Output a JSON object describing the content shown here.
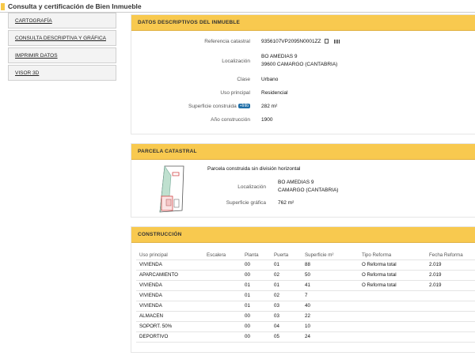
{
  "page": {
    "title": "Consulta y certificación de Bien Inmueble"
  },
  "colors": {
    "accent": "#f8c94f",
    "info_badge": "#1f6fa8"
  },
  "sidebar": {
    "items": [
      {
        "label": "CARTOGRAFÍA"
      },
      {
        "label": "CONSULTA DESCRIPTIVA Y GRÁFICA"
      },
      {
        "label": "IMPRIMIR DATOS"
      },
      {
        "label": "VISOR 3D"
      }
    ]
  },
  "datos": {
    "header": "DATOS DESCRIPTIVOS DEL INMUEBLE",
    "ref_label": "Referencia catastral",
    "ref_value": "9356107VP2095N0001ZZ",
    "loc_label": "Localización",
    "loc_line1": "BO AMEDIAS 9",
    "loc_line2": "39600 CAMARGO (CANTABRIA)",
    "clase_label": "Clase",
    "clase_value": "Urbano",
    "uso_label": "Uso principal",
    "uso_value": "Residencial",
    "sup_label": "Superficie construida",
    "sup_badge": "+Info",
    "sup_value": "282 m²",
    "anio_label": "Año construcción",
    "anio_value": "1900"
  },
  "parcela": {
    "header": "PARCELA CATASTRAL",
    "subtitle": "Parcela construida sin división horizontal",
    "loc_label": "Localización",
    "loc_line1": "BO AMEDIAS 9",
    "loc_line2": "CAMARGO (CANTABRIA)",
    "sup_label": "Superficie gráfica",
    "sup_value": "762 m²"
  },
  "construccion": {
    "header": "CONSTRUCCIÓN",
    "columns": [
      "Uso principal",
      "Escalera",
      "Planta",
      "Puerta",
      "Superficie m²",
      "Tipo Reforma",
      "Fecha Reforma"
    ],
    "rows": [
      [
        "VIVIENDA",
        "",
        "00",
        "01",
        "88",
        "O Reforma total",
        "2.019"
      ],
      [
        "APARCAMIENTO",
        "",
        "00",
        "02",
        "50",
        "O Reforma total",
        "2.019"
      ],
      [
        "VIVIENDA",
        "",
        "01",
        "01",
        "41",
        "O Reforma total",
        "2.019"
      ],
      [
        "VIVIENDA",
        "",
        "01",
        "02",
        "7",
        "",
        ""
      ],
      [
        "VIVIENDA",
        "",
        "01",
        "03",
        "40",
        "",
        ""
      ],
      [
        "ALMACEN",
        "",
        "00",
        "03",
        "22",
        "",
        ""
      ],
      [
        "SOPORT. 50%",
        "",
        "00",
        "04",
        "10",
        "",
        ""
      ],
      [
        "DEPORTIVO",
        "",
        "00",
        "05",
        "24",
        "",
        ""
      ]
    ]
  }
}
